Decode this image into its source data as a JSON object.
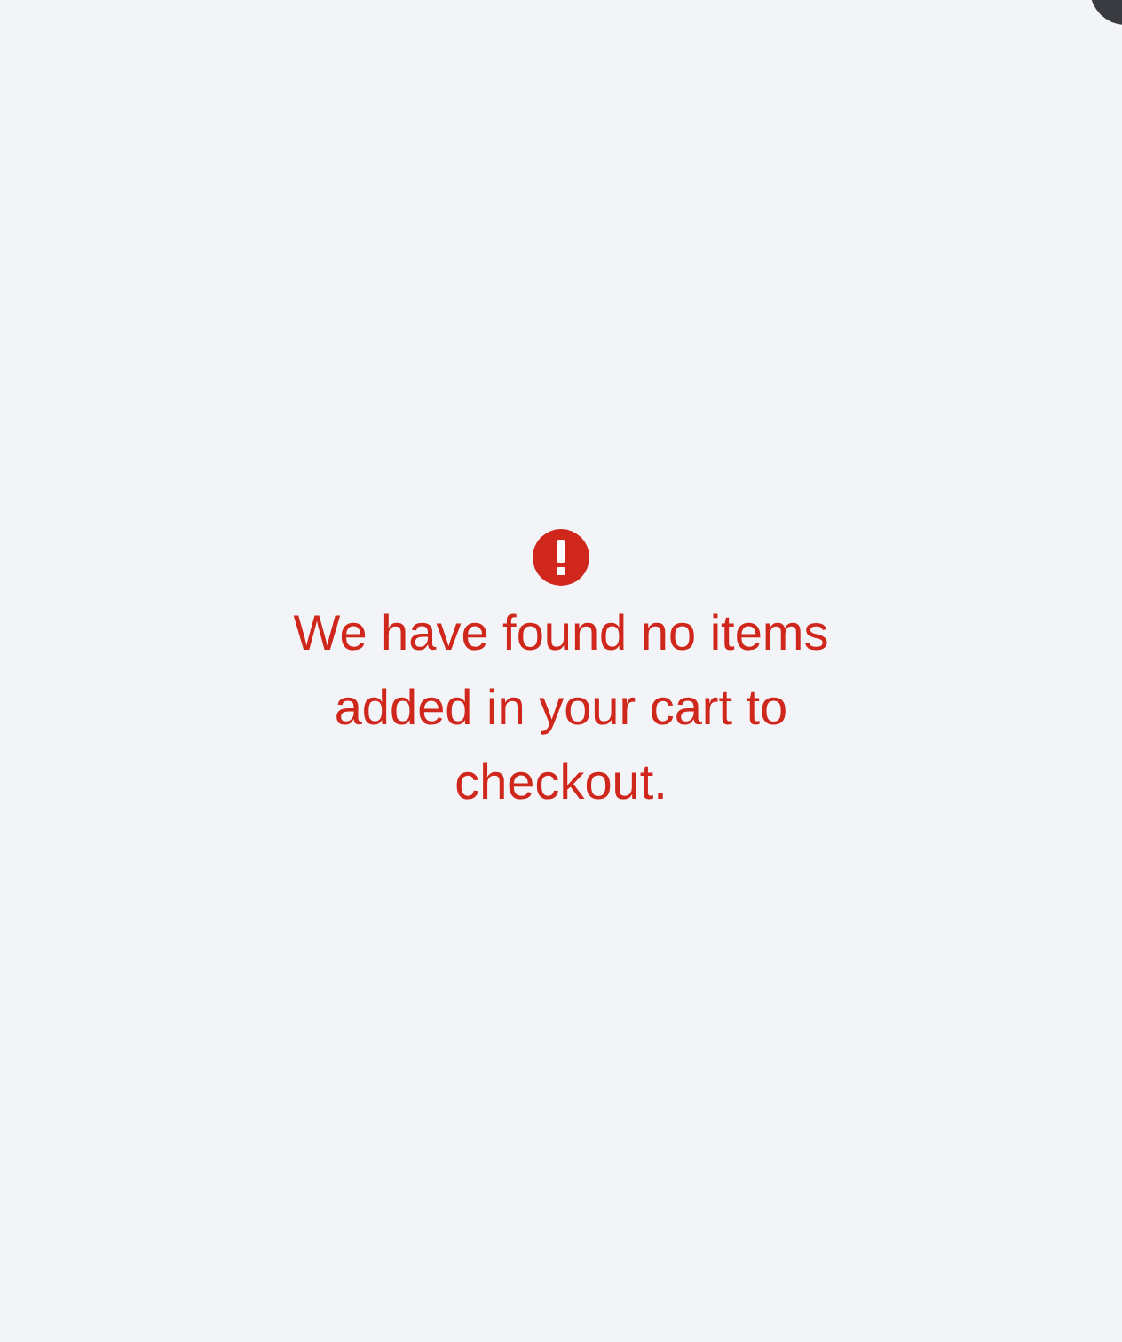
{
  "message": {
    "kind": "error",
    "text": "We have found no items added in your cart to checkout."
  }
}
